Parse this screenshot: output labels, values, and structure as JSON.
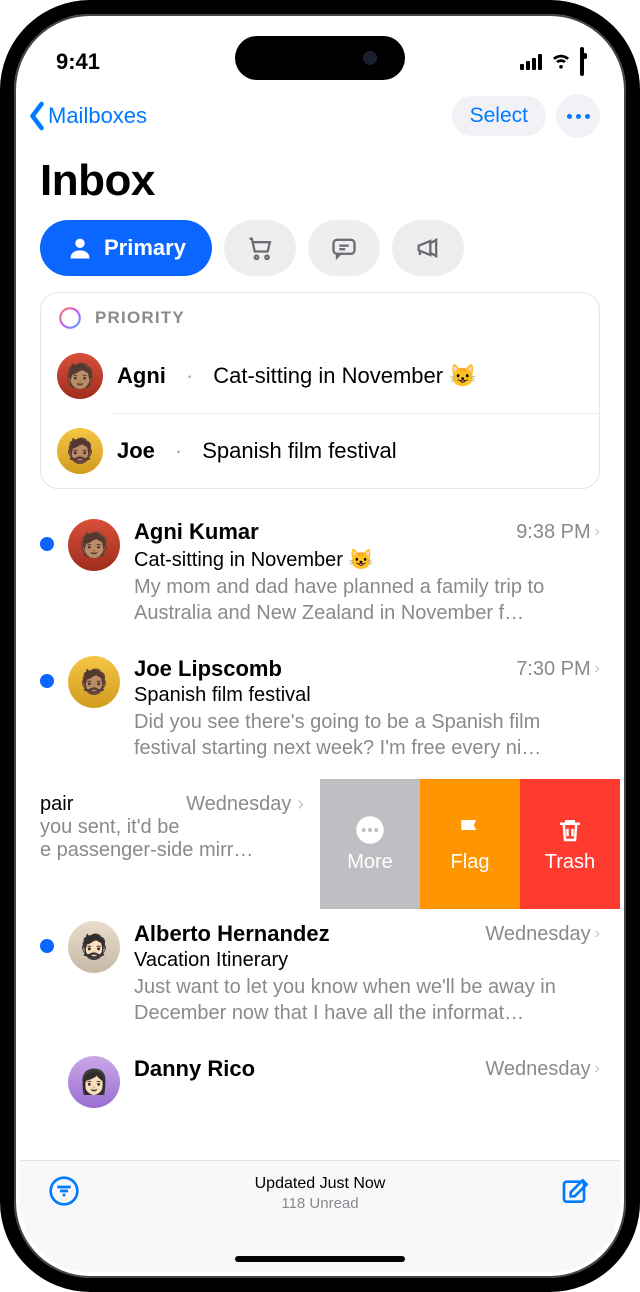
{
  "status": {
    "time": "9:41"
  },
  "nav": {
    "back_label": "Mailboxes",
    "select_label": "Select"
  },
  "title": "Inbox",
  "categories": {
    "primary_label": "Primary"
  },
  "priority": {
    "header": "PRIORITY",
    "items": [
      {
        "name": "Agni",
        "subject": "Cat-sitting in November 😺"
      },
      {
        "name": "Joe",
        "subject": "Spanish film festival"
      }
    ]
  },
  "messages": [
    {
      "sender": "Agni Kumar",
      "time": "9:38 PM",
      "subject": "Cat-sitting in November 😺",
      "preview": "My mom and dad have planned a family trip to Australia and New Zealand in November f…",
      "unread": true
    },
    {
      "sender": "Joe Lipscomb",
      "time": "7:30 PM",
      "subject": "Spanish film festival",
      "preview": "Did you see there's going to be a Spanish film festival starting next week? I'm free every ni…",
      "unread": true
    },
    {
      "sender": "",
      "time": "Wednesday",
      "subject": "pair",
      "preview": "you sent, it'd be\ne passenger-side mirr…",
      "unread": false,
      "swiped": true,
      "actions": {
        "more_label": "More",
        "flag_label": "Flag",
        "trash_label": "Trash"
      }
    },
    {
      "sender": "Alberto Hernandez",
      "time": "Wednesday",
      "subject": "Vacation Itinerary",
      "preview": "Just want to let you know when we'll be away in December now that I have all the informat…",
      "unread": true
    },
    {
      "sender": "Danny Rico",
      "time": "Wednesday",
      "subject": "",
      "preview": "",
      "unread": false
    }
  ],
  "toolbar": {
    "status_line": "Updated Just Now",
    "unread_line": "118 Unread"
  }
}
